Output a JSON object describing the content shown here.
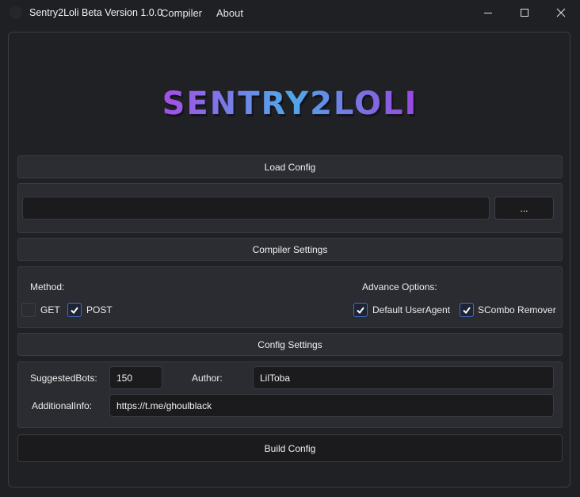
{
  "window": {
    "title": "Sentry2Loli Beta Version 1.0.0",
    "menu": [
      "Compiler",
      "About"
    ],
    "controls": [
      "minimize",
      "maximize",
      "close"
    ]
  },
  "logo": {
    "text": "SENTRY2LOLI",
    "colors": {
      "start": "#a64de6",
      "middle": "#4fa8e8",
      "end": "#9b47e0"
    }
  },
  "load_config": {
    "header": "Load Config",
    "path_value": "",
    "browse_label": "..."
  },
  "compiler_settings": {
    "header": "Compiler Settings",
    "method_label": "Method:",
    "methods": [
      {
        "label": "GET",
        "checked": false
      },
      {
        "label": "POST",
        "checked": true
      }
    ],
    "advance_label": "Advance Options:",
    "advance_options": [
      {
        "label": "Default UserAgent",
        "checked": true
      },
      {
        "label": "SCombo Remover",
        "checked": true
      }
    ]
  },
  "config_settings": {
    "header": "Config Settings",
    "suggested_bots_label": "SuggestedBots:",
    "suggested_bots_value": "150",
    "author_label": "Author:",
    "author_value": "LilToba",
    "additional_info_label": "AdditionalInfo:",
    "additional_info_value": "https://t.me/ghoulblack"
  },
  "build_button": "Build Config",
  "colors": {
    "background": "#1f2024",
    "panel": "#2b2c31",
    "input": "#1b1b1d",
    "checkbox_accent": "#3f6fc6"
  }
}
